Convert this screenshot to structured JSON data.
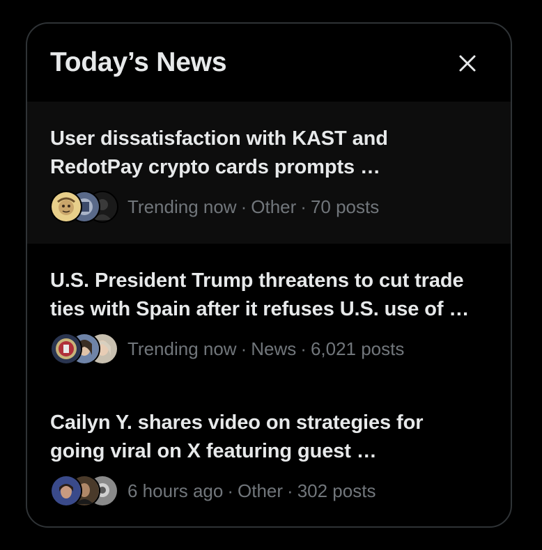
{
  "panel": {
    "title": "Today’s News",
    "close_icon": "close-icon"
  },
  "items": [
    {
      "headline_line1": "User dissatisfaction with KAST and",
      "headline_line2": "RedotPay crypto cards prompts …",
      "time": "Trending now",
      "category": "Other",
      "posts": "70 posts"
    },
    {
      "headline_line1": "U.S. President Trump threatens to cut trade",
      "headline_line2": "ties with Spain after it refuses U.S. use of …",
      "time": "Trending now",
      "category": "News",
      "posts": "6,021 posts"
    },
    {
      "headline_line1": "Cailyn Y. shares video on strategies for",
      "headline_line2": "going viral on X featuring guest …",
      "time": "6 hours ago",
      "category": "Other",
      "posts": "302 posts"
    }
  ],
  "colors": {
    "background": "#000000",
    "text_primary": "#e7e9ea",
    "text_secondary": "#71767b",
    "border": "#2f3336",
    "highlight_row": "#0d0d0d"
  }
}
